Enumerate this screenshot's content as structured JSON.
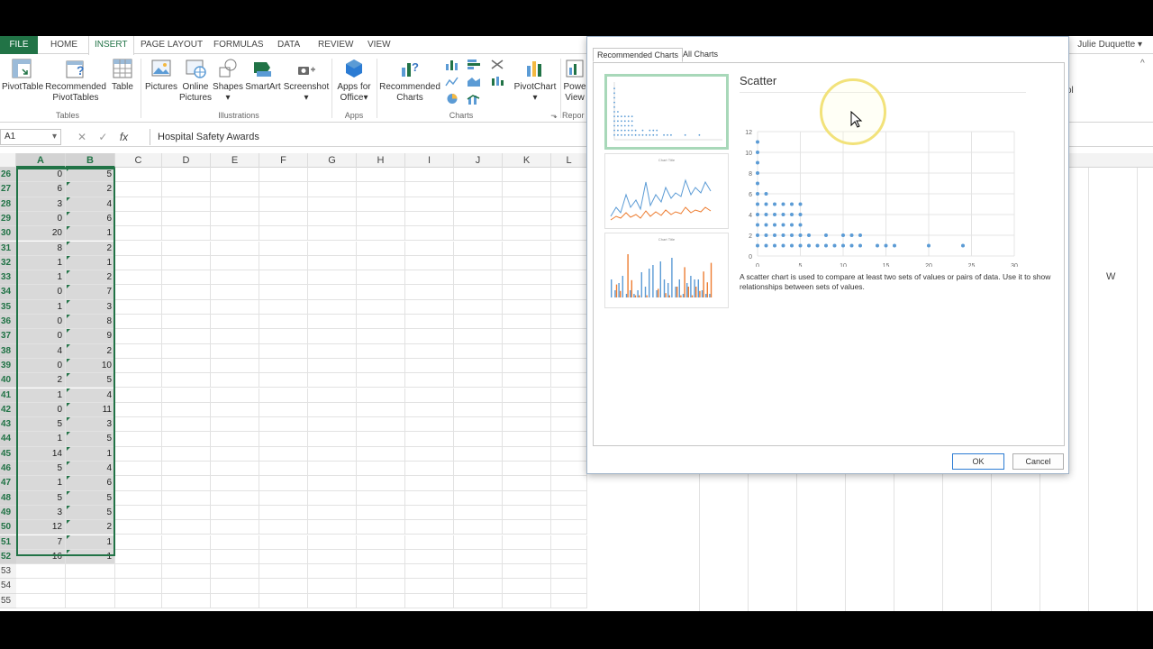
{
  "ribbon_tabs": [
    "FILE",
    "HOME",
    "INSERT",
    "PAGE LAYOUT",
    "FORMULAS",
    "DATA",
    "REVIEW",
    "VIEW"
  ],
  "user_name": "Julie Duquette",
  "ribbon": {
    "pivottable": "PivotTable",
    "recommended_pivottables_1": "Recommended",
    "recommended_pivottables_2": "PivotTables",
    "table": "Table",
    "pictures": "Pictures",
    "online_pictures_1": "Online",
    "online_pictures_2": "Pictures",
    "shapes": "Shapes",
    "smartart": "SmartArt",
    "screenshot": "Screenshot",
    "apps_1": "Apps for",
    "apps_2": "Office",
    "recommended_charts_1": "Recommended",
    "recommended_charts_2": "Charts",
    "pivotchart": "PivotChart",
    "power_view_1": "Powe",
    "power_view_2": "View",
    "group_tables": "Tables",
    "group_illustrations": "Illustrations",
    "group_apps": "Apps",
    "group_charts": "Charts",
    "group_reports": "Repor",
    "trailing_label": "ol"
  },
  "formula_bar": {
    "name_box": "A1",
    "value": "Hospital Safety Awards"
  },
  "columns": [
    "A",
    "B",
    "C",
    "D",
    "E",
    "F",
    "G",
    "H",
    "I",
    "J",
    "K",
    "L"
  ],
  "extra_column": "W",
  "rows": [
    {
      "n": "26",
      "a": "0",
      "b": "5"
    },
    {
      "n": "27",
      "a": "6",
      "b": "2"
    },
    {
      "n": "28",
      "a": "3",
      "b": "4"
    },
    {
      "n": "29",
      "a": "0",
      "b": "6"
    },
    {
      "n": "30",
      "a": "20",
      "b": "1"
    },
    {
      "n": "31",
      "a": "8",
      "b": "2"
    },
    {
      "n": "32",
      "a": "1",
      "b": "1"
    },
    {
      "n": "33",
      "a": "1",
      "b": "2"
    },
    {
      "n": "34",
      "a": "0",
      "b": "7"
    },
    {
      "n": "35",
      "a": "1",
      "b": "3"
    },
    {
      "n": "36",
      "a": "0",
      "b": "8"
    },
    {
      "n": "37",
      "a": "0",
      "b": "9"
    },
    {
      "n": "38",
      "a": "4",
      "b": "2"
    },
    {
      "n": "39",
      "a": "0",
      "b": "10"
    },
    {
      "n": "40",
      "a": "2",
      "b": "5"
    },
    {
      "n": "41",
      "a": "1",
      "b": "4"
    },
    {
      "n": "42",
      "a": "0",
      "b": "11"
    },
    {
      "n": "43",
      "a": "5",
      "b": "3"
    },
    {
      "n": "44",
      "a": "1",
      "b": "5"
    },
    {
      "n": "45",
      "a": "14",
      "b": "1"
    },
    {
      "n": "46",
      "a": "5",
      "b": "4"
    },
    {
      "n": "47",
      "a": "1",
      "b": "6"
    },
    {
      "n": "48",
      "a": "5",
      "b": "5"
    },
    {
      "n": "49",
      "a": "3",
      "b": "5"
    },
    {
      "n": "50",
      "a": "12",
      "b": "2"
    },
    {
      "n": "51",
      "a": "7",
      "b": "1"
    },
    {
      "n": "52",
      "a": "16",
      "b": "1"
    },
    {
      "n": "53",
      "a": "",
      "b": ""
    },
    {
      "n": "54",
      "a": "",
      "b": ""
    },
    {
      "n": "55",
      "a": "",
      "b": ""
    }
  ],
  "dialog": {
    "tab_recommended": "Recommended Charts",
    "tab_all": "All Charts",
    "thumb_title": "Chart Title",
    "chart_name": "Scatter",
    "description": "A scatter chart is used to compare at least two sets of values or pairs of data. Use it to show relationships between sets of values.",
    "ok": "OK",
    "cancel": "Cancel"
  },
  "chart_data": {
    "type": "scatter",
    "xlim": [
      0,
      30
    ],
    "ylim": [
      0,
      12
    ],
    "x_ticks": [
      0,
      5,
      10,
      15,
      20,
      25,
      30
    ],
    "y_ticks": [
      0,
      2,
      4,
      6,
      8,
      10,
      12
    ],
    "point_color": "#5b9bd5",
    "points": [
      [
        0,
        1
      ],
      [
        0,
        2
      ],
      [
        0,
        3
      ],
      [
        0,
        4
      ],
      [
        0,
        5
      ],
      [
        0,
        6
      ],
      [
        0,
        7
      ],
      [
        0,
        8
      ],
      [
        0,
        9
      ],
      [
        0,
        10
      ],
      [
        0,
        11
      ],
      [
        1,
        1
      ],
      [
        1,
        2
      ],
      [
        1,
        3
      ],
      [
        1,
        4
      ],
      [
        1,
        5
      ],
      [
        1,
        6
      ],
      [
        2,
        1
      ],
      [
        2,
        2
      ],
      [
        2,
        3
      ],
      [
        2,
        4
      ],
      [
        2,
        5
      ],
      [
        3,
        1
      ],
      [
        3,
        2
      ],
      [
        3,
        3
      ],
      [
        3,
        4
      ],
      [
        3,
        5
      ],
      [
        4,
        1
      ],
      [
        4,
        2
      ],
      [
        4,
        3
      ],
      [
        4,
        4
      ],
      [
        4,
        5
      ],
      [
        5,
        1
      ],
      [
        5,
        2
      ],
      [
        5,
        3
      ],
      [
        5,
        4
      ],
      [
        5,
        5
      ],
      [
        6,
        1
      ],
      [
        6,
        2
      ],
      [
        7,
        1
      ],
      [
        8,
        1
      ],
      [
        8,
        2
      ],
      [
        9,
        1
      ],
      [
        10,
        1
      ],
      [
        10,
        2
      ],
      [
        11,
        1
      ],
      [
        11,
        2
      ],
      [
        12,
        1
      ],
      [
        12,
        2
      ],
      [
        14,
        1
      ],
      [
        15,
        1
      ],
      [
        16,
        1
      ],
      [
        20,
        1
      ],
      [
        24,
        1
      ]
    ]
  },
  "colors": {
    "excel_green": "#217346",
    "selection": "#d9d9d9",
    "thumb_selected": "#a8d8b9",
    "cursor_highlight": "#f2e27a"
  }
}
